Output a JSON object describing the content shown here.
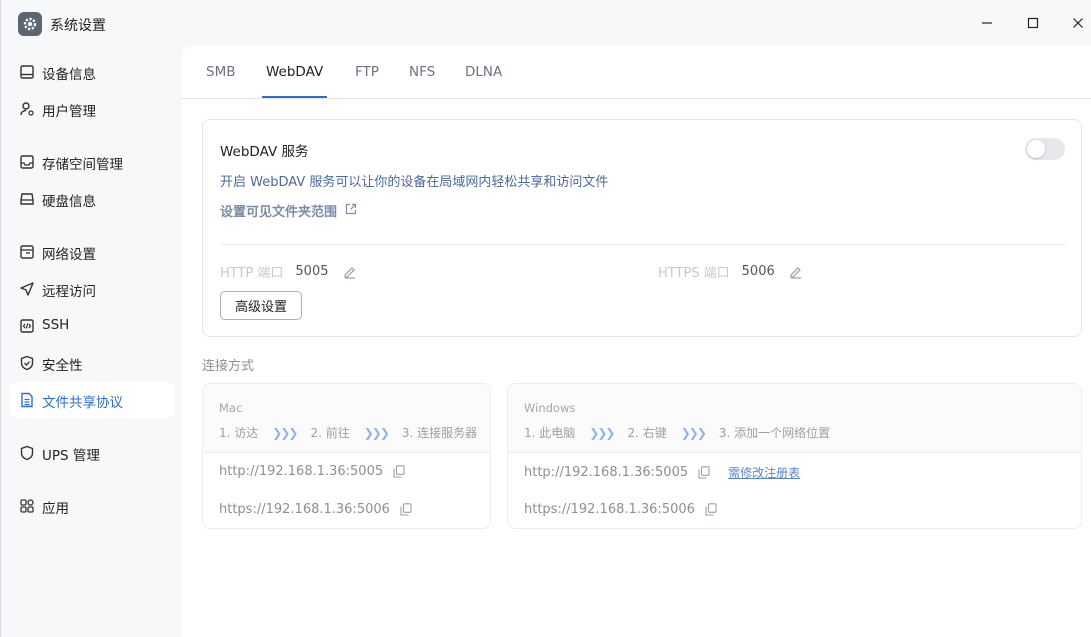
{
  "window": {
    "title": "系统设置"
  },
  "sidebar": {
    "items": [
      {
        "label": "设备信息",
        "icon": "monitor-icon"
      },
      {
        "label": "用户管理",
        "icon": "user-icon"
      },
      {
        "label": "存储空间管理",
        "icon": "storage-icon"
      },
      {
        "label": "硬盘信息",
        "icon": "disk-icon"
      },
      {
        "label": "网络设置",
        "icon": "network-icon"
      },
      {
        "label": "远程访问",
        "icon": "send-icon"
      },
      {
        "label": "SSH",
        "icon": "code-icon"
      },
      {
        "label": "安全性",
        "icon": "shield-icon"
      },
      {
        "label": "文件共享协议",
        "icon": "document-icon",
        "active": true
      },
      {
        "label": "UPS 管理",
        "icon": "ups-shield-icon"
      },
      {
        "label": "应用",
        "icon": "apps-icon"
      }
    ]
  },
  "tabs": [
    "SMB",
    "WebDAV",
    "FTP",
    "NFS",
    "DLNA"
  ],
  "active_tab": "WebDAV",
  "service": {
    "title": "WebDAV 服务",
    "enabled": false,
    "description": "开启 WebDAV 服务可以让你的设备在局域网内轻松共享和访问文件",
    "folder_link": "设置可见文件夹范围",
    "http_label": "HTTP 端口",
    "http_port": "5005",
    "https_label": "HTTPS 端口",
    "https_port": "5006",
    "advanced_button": "高级设置"
  },
  "connection": {
    "title": "连接方式",
    "mac": {
      "name": "Mac",
      "steps": [
        "1. 访达",
        "2. 前往",
        "3. 连接服务器"
      ],
      "http_url": "http://192.168.1.36:5005",
      "https_url": "https://192.168.1.36:5006"
    },
    "windows": {
      "name": "Windows",
      "steps": [
        "1. 此电脑",
        "2. 右键",
        "3. 添加一个网络位置"
      ],
      "http_url": "http://192.168.1.36:5005",
      "https_url": "https://192.168.1.36:5006",
      "registry_link": "需修改注册表"
    }
  },
  "colors": {
    "accent": "#2a6dd6",
    "sidebar_bg": "#f7f8fa",
    "content_bg": "#ffffff"
  }
}
